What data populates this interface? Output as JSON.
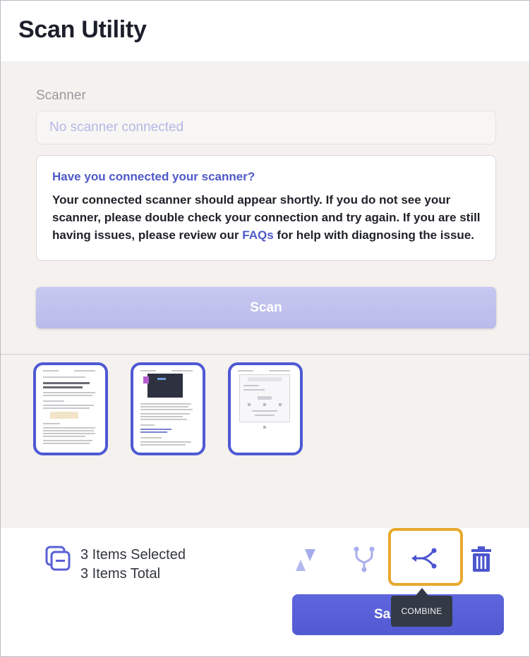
{
  "app": {
    "title": "Scan Utility"
  },
  "scanner": {
    "label": "Scanner",
    "select_value": "No scanner connected"
  },
  "info": {
    "heading": "Have you connected your scanner?",
    "body_before_link": "Your connected scanner should appear shortly. If you do not see your scanner, please double check your connection and try again. If you are still having issues, please review our ",
    "link_text": "FAQs",
    "body_after_link": " for help with diagnosing the issue."
  },
  "scan_button_label": "Scan",
  "thumbnails": [
    {
      "selected": true
    },
    {
      "selected": true
    },
    {
      "selected": true
    }
  ],
  "selection": {
    "selected_text": "3 Items Selected",
    "total_text": "3 Items Total"
  },
  "toolbar": {
    "icons": [
      "sort-icon",
      "split-icon",
      "combine-icon",
      "trash-icon"
    ],
    "tooltip": "COMBINE",
    "save_label": "Sa"
  },
  "colors": {
    "accent": "#4e59c7",
    "highlight": "#e8a82c",
    "panel_bg": "#f4f1ee",
    "tooltip_bg": "#333a45"
  }
}
